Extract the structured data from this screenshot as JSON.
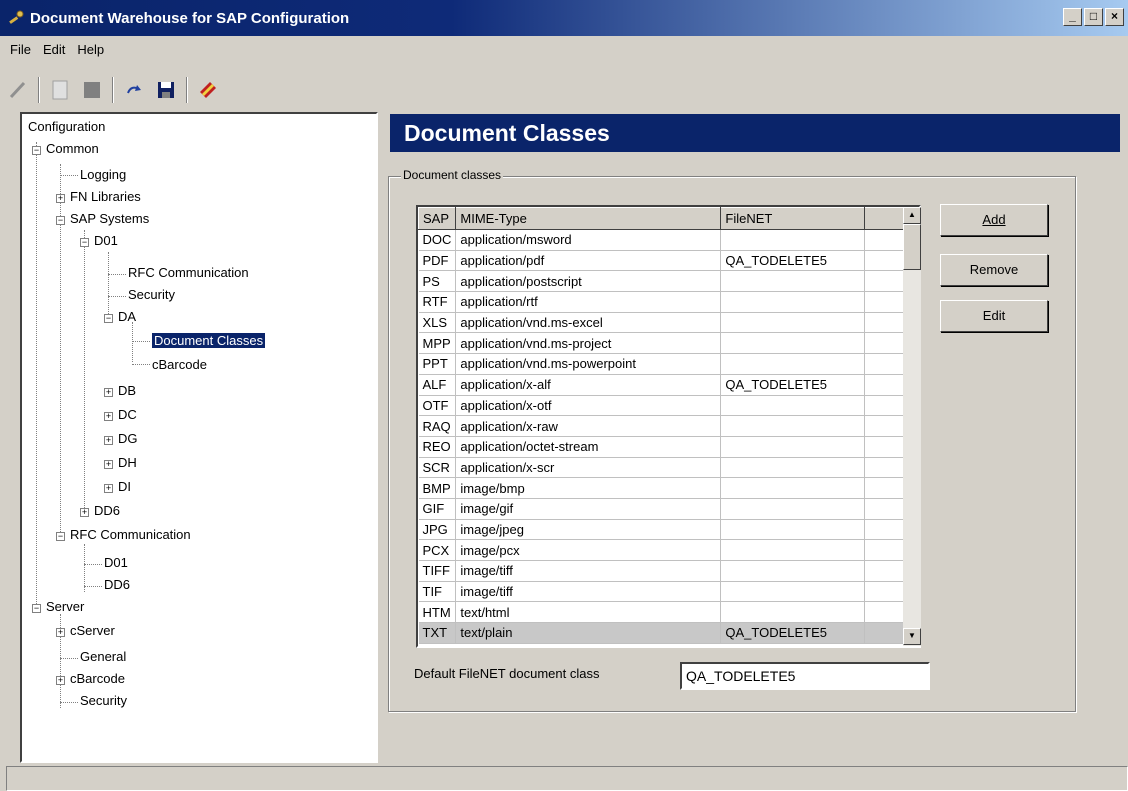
{
  "window": {
    "title": "Document Warehouse for SAP Configuration",
    "controls": [
      "_",
      "□",
      "×"
    ]
  },
  "menu": [
    "File",
    "Edit",
    "Help"
  ],
  "toolbar": [
    "pencil-icon",
    "new-document-icon",
    "gray-box-icon",
    "undo-icon",
    "save-icon",
    "book-icon"
  ],
  "tree": {
    "nodes": [
      {
        "label": "Configuration"
      },
      {
        "label": "Common"
      },
      {
        "label": "Logging"
      },
      {
        "label": "FN Libraries"
      },
      {
        "label": "SAP Systems"
      },
      {
        "label": "D01"
      },
      {
        "label": "RFC Communication"
      },
      {
        "label": "Security"
      },
      {
        "label": "DA"
      },
      {
        "label": "Document Classes"
      },
      {
        "label": "cBarcode"
      },
      {
        "label": "DB"
      },
      {
        "label": "DC"
      },
      {
        "label": "DG"
      },
      {
        "label": "DH"
      },
      {
        "label": "DI"
      },
      {
        "label": "DD6"
      },
      {
        "label": "RFC Communication"
      },
      {
        "label": "D01"
      },
      {
        "label": "DD6"
      },
      {
        "label": "Server"
      },
      {
        "label": "cServer"
      },
      {
        "label": "General"
      },
      {
        "label": "cBarcode"
      },
      {
        "label": "Security"
      }
    ]
  },
  "panel": {
    "title": "Document Classes",
    "group_label": "Document classes",
    "columns": [
      "SAP",
      "MIME-Type",
      "FileNET",
      ""
    ],
    "rows": [
      [
        "DOC",
        "application/msword",
        ""
      ],
      [
        "PDF",
        "application/pdf",
        "QA_TODELETE5"
      ],
      [
        "PS",
        "application/postscript",
        ""
      ],
      [
        "RTF",
        "application/rtf",
        ""
      ],
      [
        "XLS",
        "application/vnd.ms-excel",
        ""
      ],
      [
        "MPP",
        "application/vnd.ms-project",
        ""
      ],
      [
        "PPT",
        "application/vnd.ms-powerpoint",
        ""
      ],
      [
        "ALF",
        "application/x-alf",
        "QA_TODELETE5"
      ],
      [
        "OTF",
        "application/x-otf",
        ""
      ],
      [
        "RAQ",
        "application/x-raw",
        ""
      ],
      [
        "REO",
        "application/octet-stream",
        ""
      ],
      [
        "SCR",
        "application/x-scr",
        ""
      ],
      [
        "BMP",
        "image/bmp",
        ""
      ],
      [
        "GIF",
        "image/gif",
        ""
      ],
      [
        "JPG",
        "image/jpeg",
        ""
      ],
      [
        "PCX",
        "image/pcx",
        ""
      ],
      [
        "TIFF",
        "image/tiff",
        ""
      ],
      [
        "TIF",
        "image/tiff",
        ""
      ],
      [
        "HTM",
        "text/html",
        ""
      ],
      [
        "TXT",
        "text/plain",
        "QA_TODELETE5"
      ]
    ],
    "buttons": {
      "add": "Add",
      "remove": "Remove",
      "edit": "Edit"
    },
    "default_label": "Default FileNET document class",
    "default_value": "QA_TODELETE5"
  }
}
